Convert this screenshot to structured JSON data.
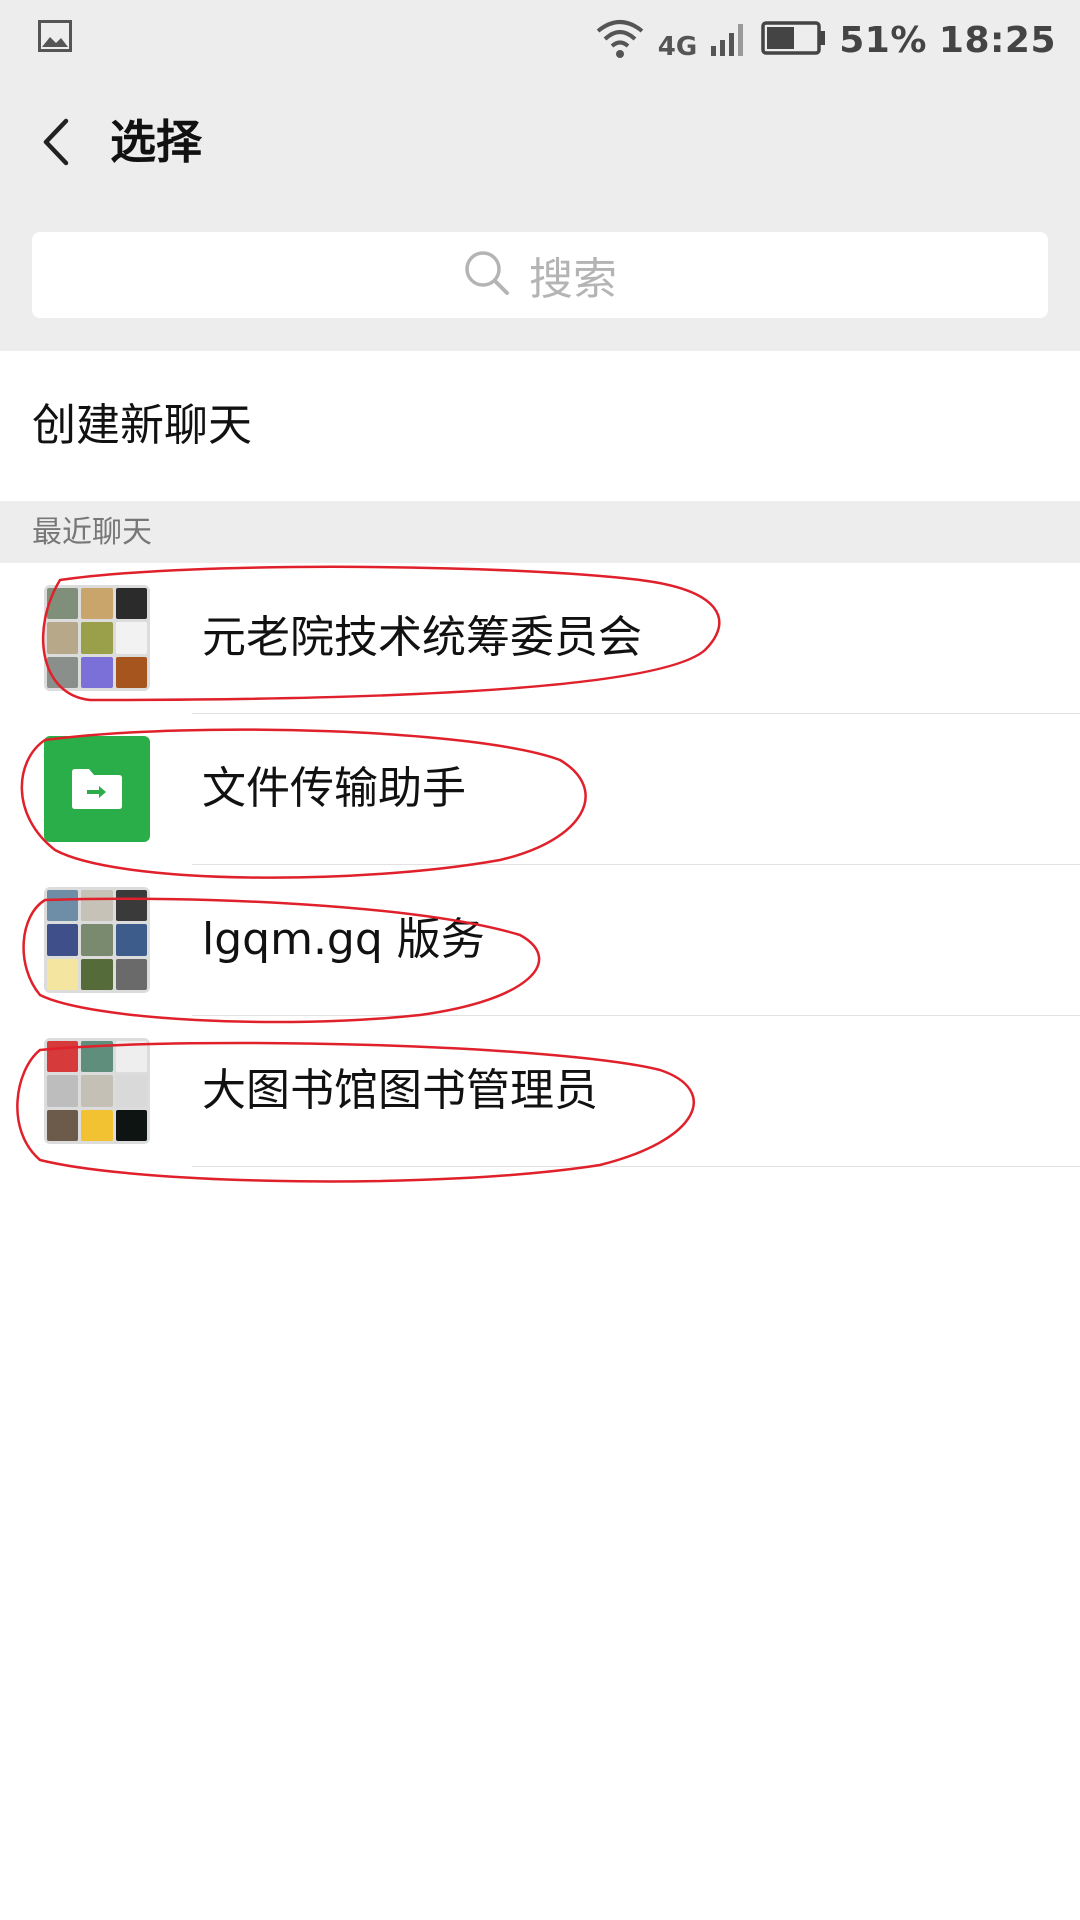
{
  "status_bar": {
    "network_type": "4G",
    "battery_percent": "51%",
    "time": "18:25"
  },
  "header": {
    "title": "选择"
  },
  "search": {
    "placeholder": "搜索"
  },
  "create_chat": {
    "label": "创建新聊天"
  },
  "recent_section": {
    "label": "最近聊天"
  },
  "chats": [
    {
      "name": "元老院技术统筹委员会",
      "avatar_type": "group-grid"
    },
    {
      "name": "文件传输助手",
      "avatar_type": "file-transfer-icon"
    },
    {
      "name": "lgqm.gq 版务",
      "avatar_type": "group-grid"
    },
    {
      "name": "大图书馆图书管理员",
      "avatar_type": "group-grid"
    }
  ],
  "colors": {
    "background_gray": "#ededed",
    "file_transfer_green": "#2aae4a",
    "annotation_red": "#e0202a"
  }
}
